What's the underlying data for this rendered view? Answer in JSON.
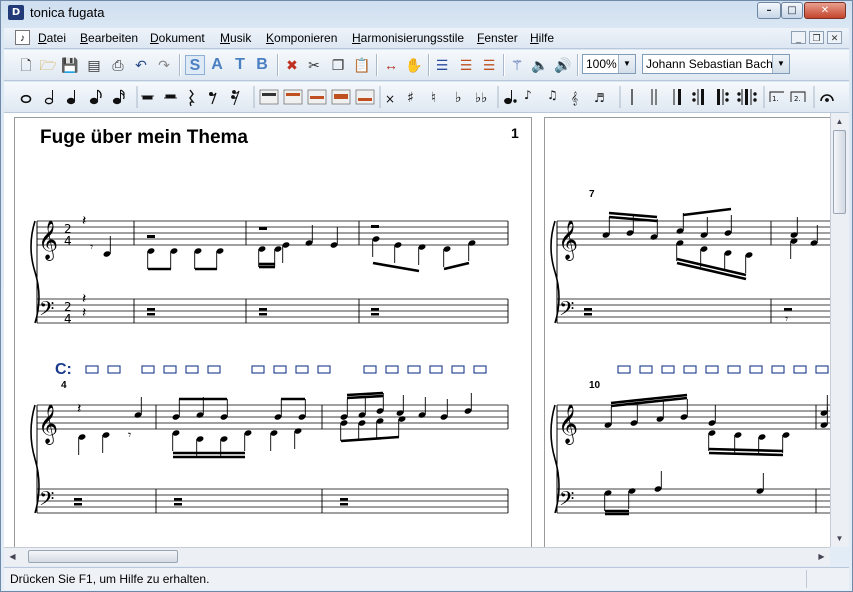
{
  "window": {
    "title": "tonica fugata",
    "app_icon": "tonica-app-icon"
  },
  "menu": {
    "items": [
      "Datei",
      "Bearbeiten",
      "Dokument",
      "Musik",
      "Komponieren",
      "Harmonisierungsstile",
      "Fenster",
      "Hilfe"
    ]
  },
  "toolbar": {
    "voice_letters": [
      "S",
      "A",
      "T",
      "B"
    ],
    "zoom": "100%",
    "style": "Johann Sebastian Bach II"
  },
  "score": {
    "title": "Fuge über mein Thema",
    "page_number": "1",
    "measure_numbers": {
      "row1_right": "7",
      "row2_left": "4",
      "row2_right": "10"
    },
    "chord_label": "C:"
  },
  "status": {
    "text": "Drücken Sie F1, um Hilfe zu erhalten."
  },
  "colors": {
    "chord_label": "#1a3a8c",
    "accent": "#4a7fc1"
  }
}
